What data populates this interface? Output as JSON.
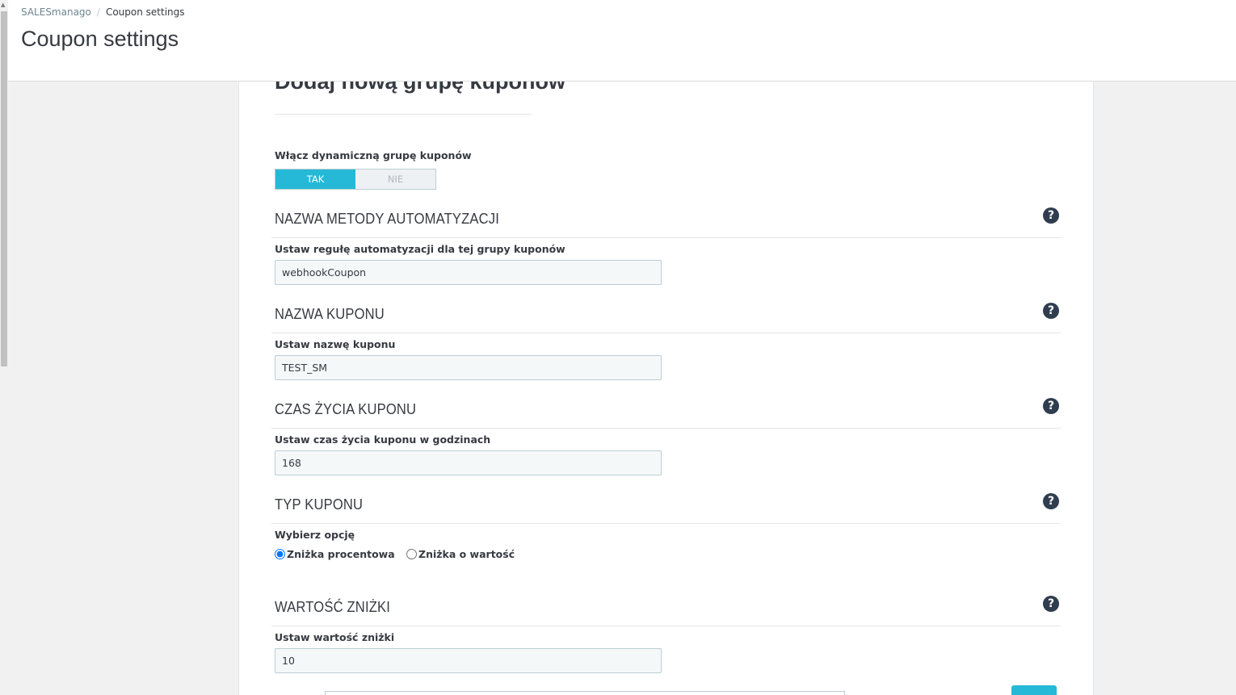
{
  "breadcrumb": {
    "parent": "SALESmanago",
    "separator": "/",
    "current": "Coupon settings"
  },
  "page_title": "Coupon settings",
  "panel": {
    "heading": "Dodaj nową grupę kuponów"
  },
  "dynamic_group": {
    "label": "Włącz dynamiczną grupę kuponów",
    "on_label": "TAK",
    "off_label": "NIE",
    "selected": "TAK"
  },
  "sections": {
    "automation": {
      "title": "NAZWA METODY AUTOMATYZACJI",
      "field_label": "Ustaw regułę automatyzacji dla tej grupy kuponów",
      "value": "webhookCoupon"
    },
    "coupon_name": {
      "title": "NAZWA KUPONU",
      "field_label": "Ustaw nazwę kuponu",
      "value": "TEST_SM"
    },
    "lifetime": {
      "title": "CZAS ŻYCIA KUPONU",
      "field_label": "Ustaw czas życia kuponu w godzinach",
      "value": "168"
    },
    "coupon_type": {
      "title": "TYP KUPONU",
      "field_label": "Wybierz opcję",
      "options": [
        "Zniżka procentowa",
        "Zniżka o wartość"
      ],
      "selected": "Zniżka procentowa"
    },
    "discount_value": {
      "title": "WARTOŚĆ ZNIŻKI",
      "field_label": "Ustaw wartość zniżki",
      "value": "10"
    }
  },
  "help_icon_glyph": "?",
  "colors": {
    "accent": "#25b9d7",
    "help_icon": "#2f3d4f",
    "text": "#363a41"
  }
}
